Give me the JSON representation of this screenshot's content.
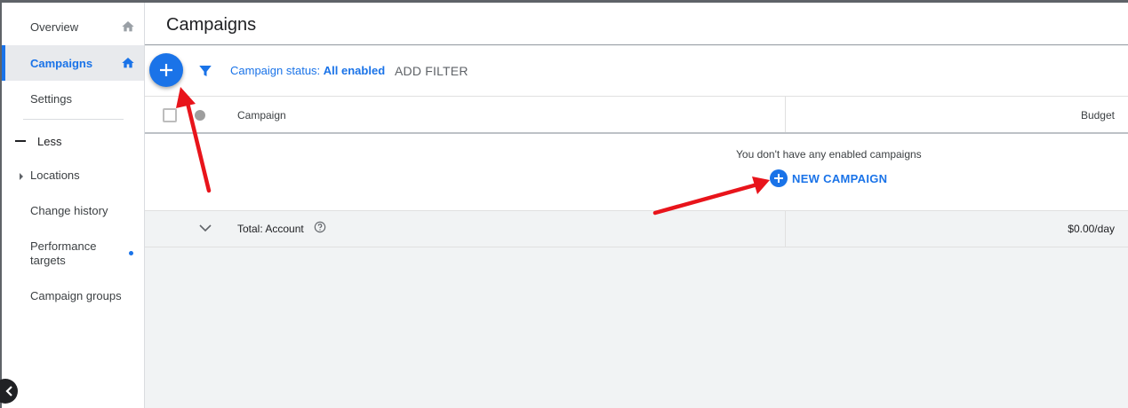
{
  "sidebar": {
    "items": [
      {
        "label": "Overview"
      },
      {
        "label": "Campaigns"
      },
      {
        "label": "Settings"
      }
    ],
    "less_label": "Less",
    "sub_items": [
      {
        "label": "Locations"
      },
      {
        "label": "Change history"
      },
      {
        "label": "Performance targets"
      },
      {
        "label": "Campaign groups"
      }
    ]
  },
  "header": {
    "title": "Campaigns"
  },
  "toolbar": {
    "status_prefix": "Campaign status: ",
    "status_value": "All enabled",
    "add_filter_label": "ADD FILTER"
  },
  "table": {
    "columns": [
      "Campaign",
      "Budget"
    ],
    "empty_message": "You don't have any enabled campaigns",
    "new_campaign_label": "NEW CAMPAIGN",
    "total_label": "Total: Account",
    "total_budget": "$0.00/day"
  },
  "colors": {
    "accent": "#1a73e8",
    "annotation_arrow": "#e8141b"
  },
  "icons": [
    "home-icon",
    "filter-icon",
    "plus-icon",
    "help-icon",
    "chevron-down-icon",
    "chevron-left-icon"
  ]
}
